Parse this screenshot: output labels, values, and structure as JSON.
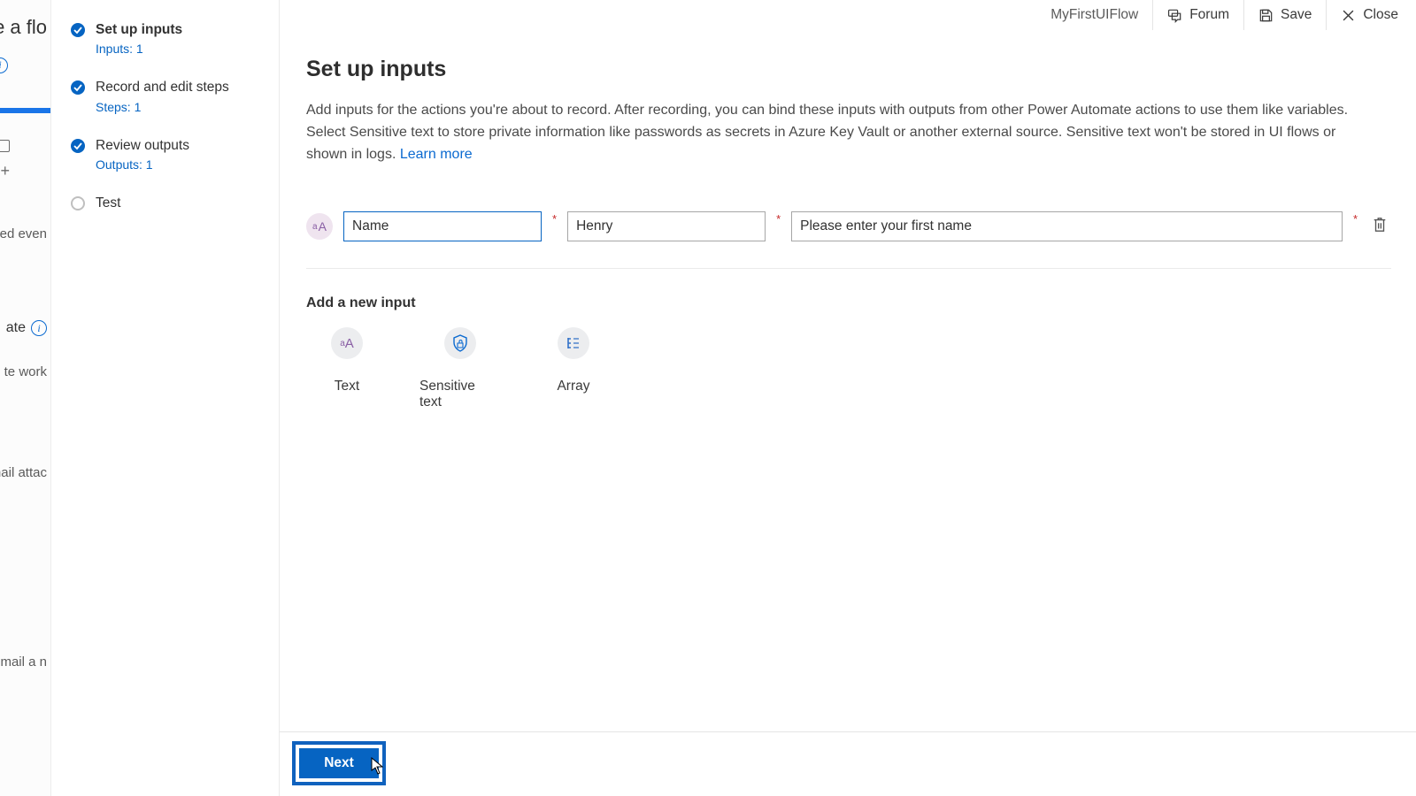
{
  "bg_left": {
    "title_frag": "ake a flo",
    "blue_tab_frag": "",
    "nated_frag": "nated even",
    "ate_frag": "ate",
    "te_work_frag": "te work",
    "mail_attac_frag": "mail attac",
    "email_a_n_frag": "email a n"
  },
  "wizard_steps": [
    {
      "title": "Set up inputs",
      "sub": "Inputs: 1",
      "done": true,
      "active": true
    },
    {
      "title": "Record and edit steps",
      "sub": "Steps: 1",
      "done": true,
      "active": false
    },
    {
      "title": "Review outputs",
      "sub": "Outputs: 1",
      "done": true,
      "active": false
    },
    {
      "title": "Test",
      "sub": "",
      "done": false,
      "active": false
    }
  ],
  "topbar": {
    "flow_name": "MyFirstUIFlow",
    "forum": "Forum",
    "save": "Save",
    "close": "Close"
  },
  "content": {
    "headline": "Set up inputs",
    "paragraph_pre_link": "Add inputs for the actions you're about to record. After recording, you can bind these inputs with outputs from other Power Automate actions to use them like variables. Select Sensitive text to store private information like passwords as secrets in Azure Key Vault or another external source. Sensitive text won't be stored in UI flows or shown in logs. ",
    "learn_more": "Learn more"
  },
  "input_row": {
    "name_value": "Name",
    "sample_value": "Henry",
    "desc_value": "Please enter your first name"
  },
  "add_section": {
    "header": "Add a new input",
    "items": [
      {
        "label": "Text"
      },
      {
        "label": "Sensitive text"
      },
      {
        "label": "Array"
      }
    ]
  },
  "footer": {
    "next": "Next"
  }
}
